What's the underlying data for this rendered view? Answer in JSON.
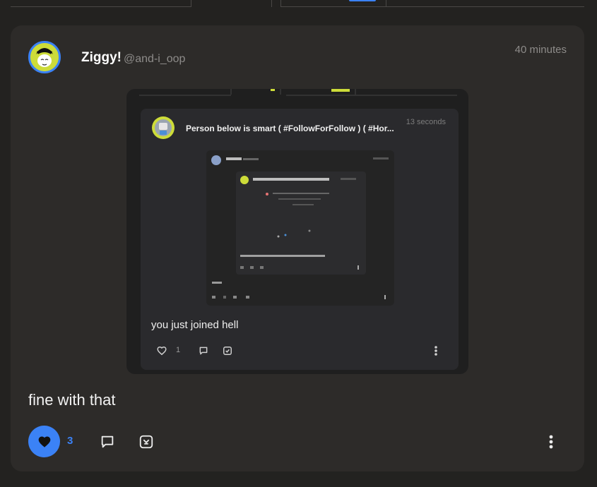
{
  "post": {
    "username": "Ziggy!",
    "handle": "@and-i_oop",
    "timestamp": "40 minutes",
    "text": "fine with that",
    "like_count": "3"
  },
  "embedded": {
    "title": "Person below is smart ( #FollowForFollow ) ( #Hor...",
    "timestamp": "13 seconds",
    "text": "you just joined hell",
    "like_count": "1"
  },
  "colors": {
    "accent": "#3b82f6",
    "card": "#2d2b29",
    "background": "#232220",
    "avatar": "#cddc39"
  },
  "icons": {
    "like": "heart-icon",
    "comment": "comment-icon",
    "share": "share-icon",
    "more": "more-vertical-icon"
  }
}
